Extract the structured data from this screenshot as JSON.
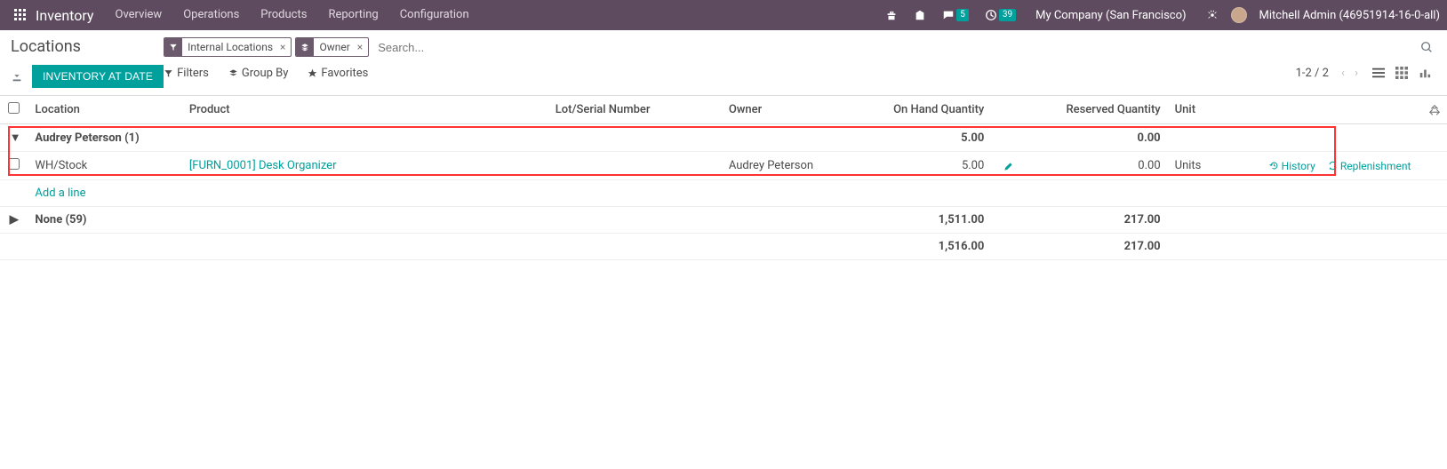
{
  "navbar": {
    "brand": "Inventory",
    "menu": [
      "Overview",
      "Operations",
      "Products",
      "Reporting",
      "Configuration"
    ],
    "msg_badge": "5",
    "act_badge": "39",
    "company": "My Company (San Francisco)",
    "user": "Mitchell Admin (46951914-16-0-all)"
  },
  "control": {
    "title": "Locations",
    "primary_btn": "INVENTORY AT DATE",
    "facets": [
      {
        "icon": "filter",
        "label": "Internal Locations"
      },
      {
        "icon": "stack",
        "label": "Owner"
      }
    ],
    "search_placeholder": "Search...",
    "filters_label": "Filters",
    "groupby_label": "Group By",
    "favorites_label": "Favorites",
    "pager": "1-2 / 2"
  },
  "columns": {
    "location": "Location",
    "product": "Product",
    "lot": "Lot/Serial Number",
    "owner": "Owner",
    "onhand": "On Hand Quantity",
    "reserved": "Reserved Quantity",
    "unit": "Unit"
  },
  "groups": [
    {
      "name": "Audrey Peterson (1)",
      "expanded": true,
      "onhand": "5.00",
      "reserved": "0.00",
      "rows": [
        {
          "location": "WH/Stock",
          "product": "[FURN_0001] Desk Organizer",
          "lot": "",
          "owner": "Audrey Peterson",
          "onhand": "5.00",
          "reserved": "0.00",
          "unit": "Units",
          "history_label": "History",
          "replenish_label": "Replenishment"
        }
      ]
    },
    {
      "name": "None (59)",
      "expanded": false,
      "onhand": "1,511.00",
      "reserved": "217.00",
      "rows": []
    }
  ],
  "add_line": "Add a line",
  "totals": {
    "onhand": "1,516.00",
    "reserved": "217.00"
  }
}
